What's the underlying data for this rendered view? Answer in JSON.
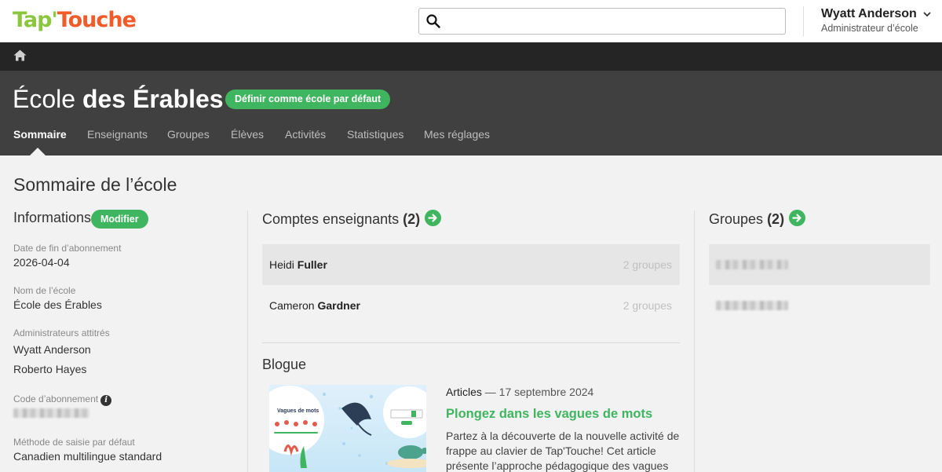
{
  "brand": {
    "tap": "Tap'",
    "touche": "Touche"
  },
  "search": {
    "placeholder": "",
    "value": ""
  },
  "user": {
    "name": "Wyatt Anderson",
    "caret": "⌄",
    "role": "Administrateur d’école"
  },
  "school": {
    "title_prefix": "École",
    "title_bold": "des Érables",
    "default_button": "Définir comme école par défaut"
  },
  "tabs": [
    {
      "label": "Sommaire",
      "active": true
    },
    {
      "label": "Enseignants"
    },
    {
      "label": "Groupes"
    },
    {
      "label": "Élèves"
    },
    {
      "label": "Activités"
    },
    {
      "label": "Statistiques"
    },
    {
      "label": "Mes réglages"
    }
  ],
  "page_title": "Sommaire de l’école",
  "info": {
    "heading": "Informations",
    "edit_button": "Modifier",
    "sub_end_label": "Date de fin d’abonnement",
    "sub_end_value": "2026-04-04",
    "school_name_label": "Nom de l’école",
    "school_name_value": "École des Érables",
    "admins_label": "Administrateurs attitrés",
    "admins": [
      "Wyatt Anderson",
      "Roberto Hayes"
    ],
    "code_label": "Code d’abonnement",
    "input_method_label": "Méthode de saisie par défaut",
    "input_method_value": "Canadien multilingue standard"
  },
  "teachers": {
    "heading": "Comptes enseignants",
    "count": "(2)",
    "rows": [
      {
        "first": "Heidi",
        "last": "Fuller",
        "groups": "2 groupes"
      },
      {
        "first": "Cameron",
        "last": "Gardner",
        "groups": "2 groupes"
      }
    ]
  },
  "blog": {
    "heading": "Blogue",
    "category": "Articles",
    "date": "— 17 septembre 2024",
    "title": "Plongez dans les vagues de mots",
    "excerpt": "Partez à la découverte de la nouvelle activité de frappe au clavier de Tap'Touche! Cet article présente l’approche pédagogique des vagues de",
    "image_caption": "Vagues de mots"
  },
  "groups": {
    "heading": "Groupes",
    "count": "(2)"
  },
  "colors": {
    "accent": "#3fb55f",
    "header_dark": "#404040",
    "crumb_dark": "#252525"
  }
}
